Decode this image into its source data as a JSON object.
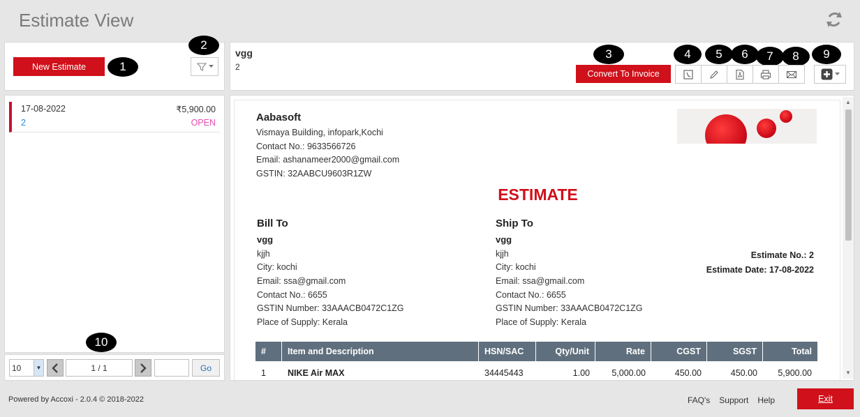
{
  "header": {
    "title": "Estimate View",
    "refresh_icon": "refresh-icon"
  },
  "left_toolbar": {
    "new_estimate_label": "New Estimate",
    "filter_icon": "filter-icon"
  },
  "annotations": [
    "1",
    "2",
    "3",
    "4",
    "5",
    "6",
    "7",
    "8",
    "9",
    "10"
  ],
  "list": {
    "items": [
      {
        "date": "17-08-2022",
        "amount": "₹5,900.00",
        "number": "2",
        "status": "OPEN"
      }
    ]
  },
  "pager": {
    "page_size": "10",
    "page": "1 / 1",
    "go_label": "Go"
  },
  "detail_header": {
    "customer_name": "vgg",
    "estimate_number": "2",
    "convert_label": "Convert To Invoice",
    "tools": [
      "history-icon",
      "edit-icon",
      "pdf-icon",
      "print-icon",
      "mail-icon"
    ],
    "more_icon": "add-icon"
  },
  "document": {
    "company": {
      "name": "Aabasoft",
      "address": "Vismaya Building, infopark,Kochi",
      "contact": "Contact No.: 9633566726",
      "email": "Email: ashanameer2000@gmail.com",
      "gstin": "GSTIN: 32AABCU9603R1ZW"
    },
    "heading": "ESTIMATE",
    "bill_to": {
      "title": "Bill To",
      "name": "vgg",
      "line1": "kjjh",
      "city": "City: kochi",
      "email": "Email: ssa@gmail.com",
      "contact": "Contact No.: 6655",
      "gstin": "GSTIN Number: 33AAACB0472C1ZG",
      "supply": "Place of Supply: Kerala"
    },
    "ship_to": {
      "title": "Ship To",
      "name": "vgg",
      "line1": "kjjh",
      "city": "City: kochi",
      "email": "Email: ssa@gmail.com",
      "contact": "Contact No.: 6655",
      "gstin": "GSTIN Number: 33AAACB0472C1ZG",
      "supply": "Place of Supply: Kerala"
    },
    "estimate_no": "Estimate No.: 2",
    "estimate_date": "Estimate Date: 17-08-2022",
    "table": {
      "headers": [
        "#",
        "Item and Description",
        "HSN/SAC",
        "Qty/Unit",
        "Rate",
        "CGST",
        "SGST",
        "Total"
      ],
      "rows": [
        [
          "1",
          "NIKE Air MAX",
          "34445443",
          "1.00",
          "5,000.00",
          "450.00",
          "450.00",
          "5,900.00"
        ]
      ]
    }
  },
  "footer": {
    "powered": "Powered by Accoxi - 2.0.4 © 2018-2022",
    "links": [
      "FAQ's",
      "Support",
      "Help"
    ],
    "exit_label": "Exit"
  },
  "colors": {
    "accent": "#d0101a",
    "table_header": "#5f6f7d",
    "status_open": "#e44db0",
    "link_blue": "#2a8bd8"
  }
}
